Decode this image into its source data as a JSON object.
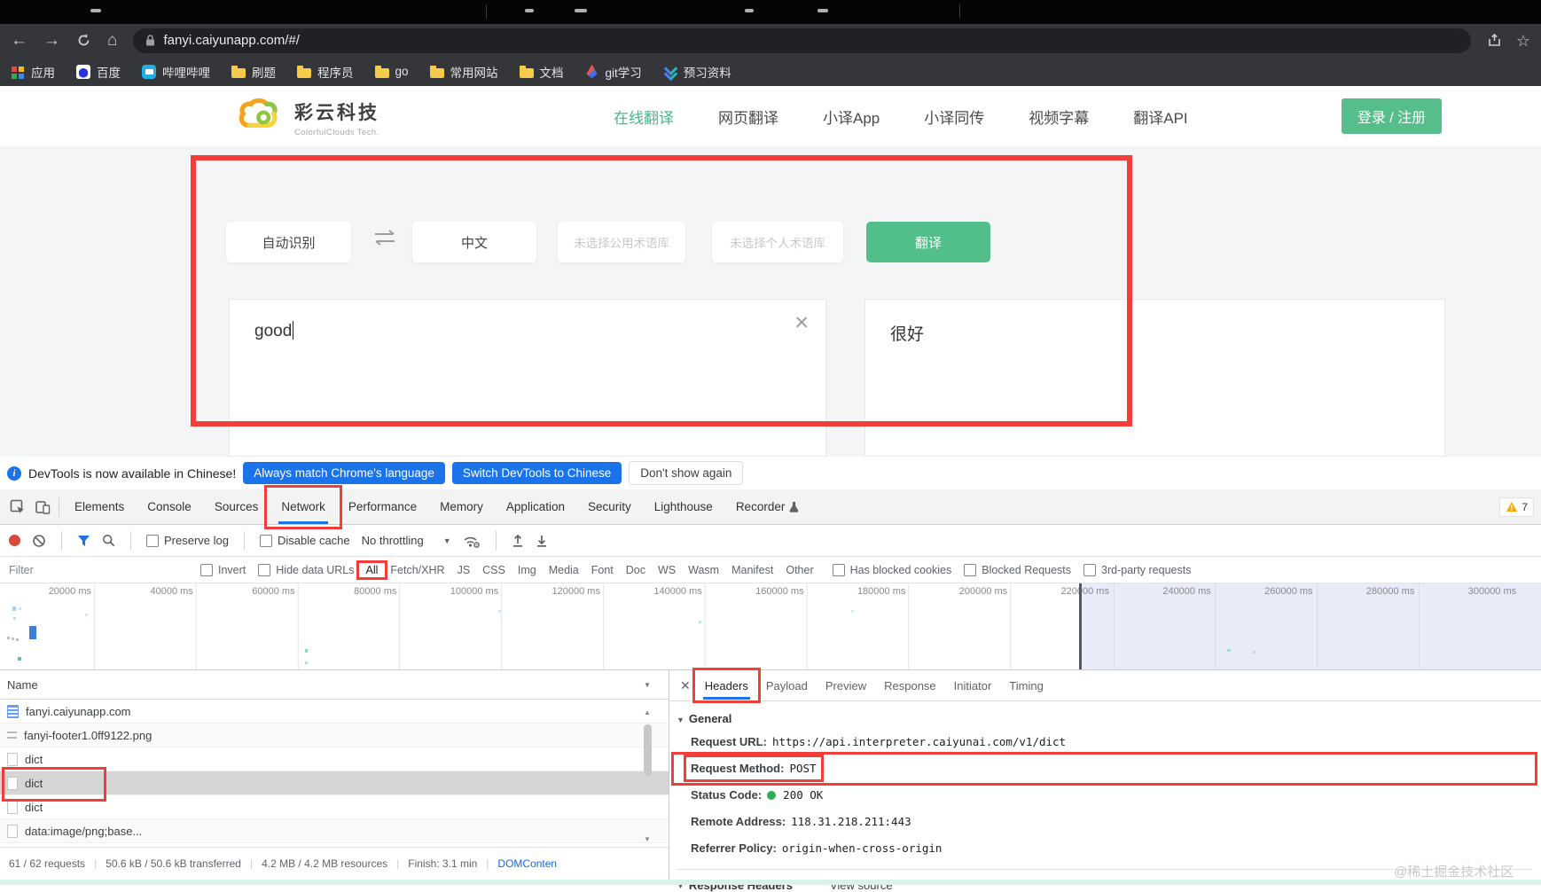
{
  "browser": {
    "url": "fanyi.caiyunapp.com/#/",
    "bookmarks": [
      {
        "label": "应用",
        "icon": "apps"
      },
      {
        "label": "百度",
        "icon": "baidu"
      },
      {
        "label": "哔哩哔哩",
        "icon": "bilibili"
      },
      {
        "label": "刷题",
        "icon": "folder"
      },
      {
        "label": "程序员",
        "icon": "folder"
      },
      {
        "label": "go",
        "icon": "folder"
      },
      {
        "label": "常用网站",
        "icon": "folder"
      },
      {
        "label": "文档",
        "icon": "folder"
      },
      {
        "label": "git学习",
        "icon": "rocket"
      },
      {
        "label": "预习资料",
        "icon": "preview"
      }
    ]
  },
  "site": {
    "brand": {
      "name": "彩云科技",
      "sub": "ColorfulClouds Tech."
    },
    "nav": [
      {
        "label": "在线翻译",
        "cls": "active"
      },
      {
        "label": "网页翻译",
        "cls": ""
      },
      {
        "label": "小译App",
        "cls": ""
      },
      {
        "label": "小译同传",
        "cls": ""
      },
      {
        "label": "视频字幕",
        "cls": ""
      },
      {
        "label": "翻译API",
        "cls": ""
      }
    ],
    "login_button": "登录 / 注册",
    "translator": {
      "source_lang": "自动识别",
      "target_lang": "中文",
      "public_glossary": "未选择公用术语库",
      "personal_glossary": "未选择个人术语库",
      "translate_button": "翻译",
      "input_text": "good",
      "output_text": "很好"
    }
  },
  "devtools": {
    "infobar": {
      "message": "DevTools is now available in Chinese!",
      "always_button": "Always match Chrome's language",
      "switch_button": "Switch DevTools to Chinese",
      "dismiss_button": "Don't show again"
    },
    "tabs": [
      {
        "label": "Elements",
        "cls": ""
      },
      {
        "label": "Console",
        "cls": ""
      },
      {
        "label": "Sources",
        "cls": ""
      },
      {
        "label": "Network",
        "cls": "active boxed"
      },
      {
        "label": "Performance",
        "cls": ""
      },
      {
        "label": "Memory",
        "cls": ""
      },
      {
        "label": "Application",
        "cls": ""
      },
      {
        "label": "Security",
        "cls": ""
      },
      {
        "label": "Lighthouse",
        "cls": ""
      },
      {
        "label": "Recorder",
        "cls": ""
      }
    ],
    "warning_count": "7",
    "toolbar": {
      "preserve_log": "Preserve log",
      "disable_cache": "Disable cache",
      "throttling": "No throttling"
    },
    "filter": {
      "placeholder": "Filter",
      "invert": "Invert",
      "hide_data_urls": "Hide data URLs",
      "chips": [
        {
          "label": "All",
          "cls": "active boxed2"
        },
        {
          "label": "Fetch/XHR",
          "cls": ""
        },
        {
          "label": "JS",
          "cls": ""
        },
        {
          "label": "CSS",
          "cls": ""
        },
        {
          "label": "Img",
          "cls": ""
        },
        {
          "label": "Media",
          "cls": ""
        },
        {
          "label": "Font",
          "cls": ""
        },
        {
          "label": "Doc",
          "cls": ""
        },
        {
          "label": "WS",
          "cls": ""
        },
        {
          "label": "Wasm",
          "cls": ""
        },
        {
          "label": "Manifest",
          "cls": ""
        },
        {
          "label": "Other",
          "cls": ""
        }
      ],
      "extra": [
        {
          "label": "Has blocked cookies"
        },
        {
          "label": "Blocked Requests"
        },
        {
          "label": "3rd-party requests"
        }
      ]
    },
    "timeline_ticks": [
      "20000 ms",
      "40000 ms",
      "60000 ms",
      "80000 ms",
      "100000 ms",
      "120000 ms",
      "140000 ms",
      "160000 ms",
      "180000 ms",
      "200000 ms",
      "220000 ms",
      "240000 ms",
      "260000 ms",
      "280000 ms",
      "300000 ms"
    ],
    "waterfall_marks": [
      {
        "l": 14,
        "t": 26,
        "w": 4,
        "h": 5,
        "c": "#a7d3f0"
      },
      {
        "l": 21,
        "t": 27,
        "w": 3,
        "h": 3,
        "c": "#c9e4f5"
      },
      {
        "l": 15,
        "t": 38,
        "w": 3,
        "h": 3,
        "c": "#c2dff2"
      },
      {
        "l": 33,
        "t": 48,
        "w": 8,
        "h": 15,
        "c": "#3d7fd4"
      },
      {
        "l": 8,
        "t": 60,
        "w": 3,
        "h": 3,
        "c": "#bdbdbd"
      },
      {
        "l": 13,
        "t": 61,
        "w": 3,
        "h": 3,
        "c": "#c6c6c6"
      },
      {
        "l": 18,
        "t": 62,
        "w": 3,
        "h": 3,
        "c": "#bdbdbd"
      },
      {
        "l": 20,
        "t": 83,
        "w": 4,
        "h": 4,
        "c": "#62c4b2"
      },
      {
        "l": 96,
        "t": 34,
        "w": 3,
        "h": 3,
        "c": "#d5e9dd"
      },
      {
        "l": 344,
        "t": 74,
        "w": 3,
        "h": 4,
        "c": "#8ed6c6"
      },
      {
        "l": 344,
        "t": 88,
        "w": 3,
        "h": 3,
        "c": "#aee1d6"
      },
      {
        "l": 562,
        "t": 30,
        "w": 3,
        "h": 3,
        "c": "#d7e6f2"
      },
      {
        "l": 788,
        "t": 42,
        "w": 3,
        "h": 3,
        "c": "#c4e6dd"
      },
      {
        "l": 960,
        "t": 30,
        "w": 3,
        "h": 3,
        "c": "#dbe9f4"
      },
      {
        "l": 1384,
        "t": 74,
        "w": 4,
        "h": 3,
        "c": "#a5dccf"
      },
      {
        "l": 1413,
        "t": 76,
        "w": 3,
        "h": 3,
        "c": "#b9e4da"
      }
    ],
    "requests": {
      "header": "Name",
      "rows": [
        {
          "name": "fanyi.caiyunapp.com",
          "icon": "doc",
          "cls": ""
        },
        {
          "name": "fanyi-footer1.0ff9122.png",
          "icon": "img",
          "cls": ""
        },
        {
          "name": "dict",
          "icon": "plain",
          "cls": ""
        },
        {
          "name": "dict",
          "icon": "plain",
          "cls": "selected"
        },
        {
          "name": "dict",
          "icon": "plain",
          "cls": ""
        },
        {
          "name": "data:image/png;base...",
          "icon": "plain",
          "cls": ""
        }
      ]
    },
    "details": {
      "tabs": [
        {
          "label": "Headers",
          "cls": "active boxed2"
        },
        {
          "label": "Payload",
          "cls": ""
        },
        {
          "label": "Preview",
          "cls": ""
        },
        {
          "label": "Response",
          "cls": ""
        },
        {
          "label": "Initiator",
          "cls": ""
        },
        {
          "label": "Timing",
          "cls": ""
        }
      ],
      "general": {
        "title": "General",
        "fields": [
          {
            "label": "Request URL:",
            "value": "https://api.interpreter.caiyunai.com/v1/dict",
            "cls": ""
          },
          {
            "label": "Request Method:",
            "value": "POST",
            "cls": "boxed"
          },
          {
            "label": "Status Code:",
            "value": "200 OK",
            "cls": "withdot"
          },
          {
            "label": "Remote Address:",
            "value": "118.31.218.211:443",
            "cls": ""
          },
          {
            "label": "Referrer Policy:",
            "value": "origin-when-cross-origin",
            "cls": ""
          }
        ]
      },
      "response_headers": {
        "title": "Response Headers",
        "action": "View source"
      }
    },
    "status_bar": [
      {
        "text": "61 / 62 requests",
        "cls": ""
      },
      {
        "text": "50.6 kB / 50.6 kB transferred",
        "cls": ""
      },
      {
        "text": "4.2 MB / 4.2 MB resources",
        "cls": ""
      },
      {
        "text": "Finish: 3.1 min",
        "cls": ""
      },
      {
        "text": "DOMConten",
        "cls": "link"
      }
    ]
  },
  "watermark": "@稀土掘金技术社区",
  "colors": {
    "brand_green": "#52bf8a",
    "devtools_accent": "#1a73e8",
    "annotation_red": "#f23d39",
    "status_ok_green": "#2eb052",
    "chrome_dark": "#35363a"
  }
}
